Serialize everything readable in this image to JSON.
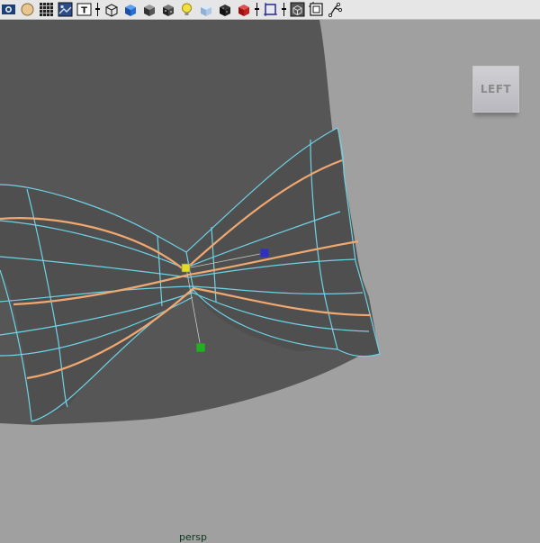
{
  "toolbar": {
    "buttons": [
      {
        "name": "select-camera-icon"
      },
      {
        "name": "wireframe-shaded-icon"
      },
      {
        "name": "grid-icon"
      },
      {
        "name": "image-plane-icon"
      },
      {
        "name": "text-tool-icon"
      },
      {
        "name": "wireframe-cube-icon"
      },
      {
        "name": "smooth-shade-icon"
      },
      {
        "name": "default-material-icon"
      },
      {
        "name": "textured-icon"
      },
      {
        "name": "use-lights-icon"
      },
      {
        "name": "shadows-icon"
      },
      {
        "name": "xray-icon"
      },
      {
        "name": "isolate-select-icon"
      },
      {
        "name": "backface-culling-icon"
      },
      {
        "name": "frame-all-icon"
      },
      {
        "name": "resolution-gate-icon"
      }
    ]
  },
  "viewport": {
    "view_cube_label": "LEFT",
    "camera_label": "persp",
    "colors": {
      "background": "#a0a0a0",
      "mesh": "#565656",
      "wire": "#6ed3e6",
      "edge_loop": "#f0a870",
      "pivot_yellow": "#e0e020",
      "pivot_blue": "#3030c0",
      "pivot_green": "#20b020"
    }
  }
}
